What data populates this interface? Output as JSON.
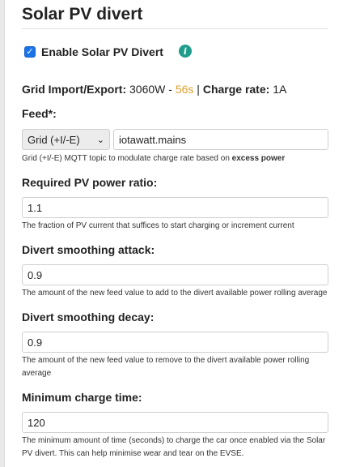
{
  "page": {
    "title": "Solar PV divert"
  },
  "enable": {
    "label": "Enable Solar PV Divert",
    "checked": true,
    "info_icon": "info-icon"
  },
  "status": {
    "grid_label": "Grid Import/Export:",
    "grid_value": "3060W",
    "separator": " - ",
    "age": "56s",
    "pipe": " | ",
    "charge_label": "Charge rate:",
    "charge_value": "1A"
  },
  "feed": {
    "label": "Feed*:",
    "select_value": "Grid (+I/-E)",
    "topic_value": "iotawatt.mains",
    "help_prefix": "Grid (+I/-E) MQTT topic to modulate charge rate based on ",
    "help_bold": "excess power"
  },
  "pv_ratio": {
    "label": "Required PV power ratio:",
    "value": "1.1",
    "help": "The fraction of PV current that suffices to start charging or increment current"
  },
  "attack": {
    "label": "Divert smoothing attack:",
    "value": "0.9",
    "help": "The amount of the new feed value to add to the divert available power rolling average"
  },
  "decay": {
    "label": "Divert smoothing decay:",
    "value": "0.9",
    "help": "The amount of the new feed value to remove to the divert available power rolling average"
  },
  "min_time": {
    "label": "Minimum charge time:",
    "value": "120",
    "help": "The minimum amount of time (seconds) to charge the car once enabled via the Solar PV divert. This can help minimise wear and tear on the EVSE."
  },
  "colors": {
    "accent": "#1a73e8",
    "info": "#1f9c8b",
    "age": "#e0a030"
  }
}
